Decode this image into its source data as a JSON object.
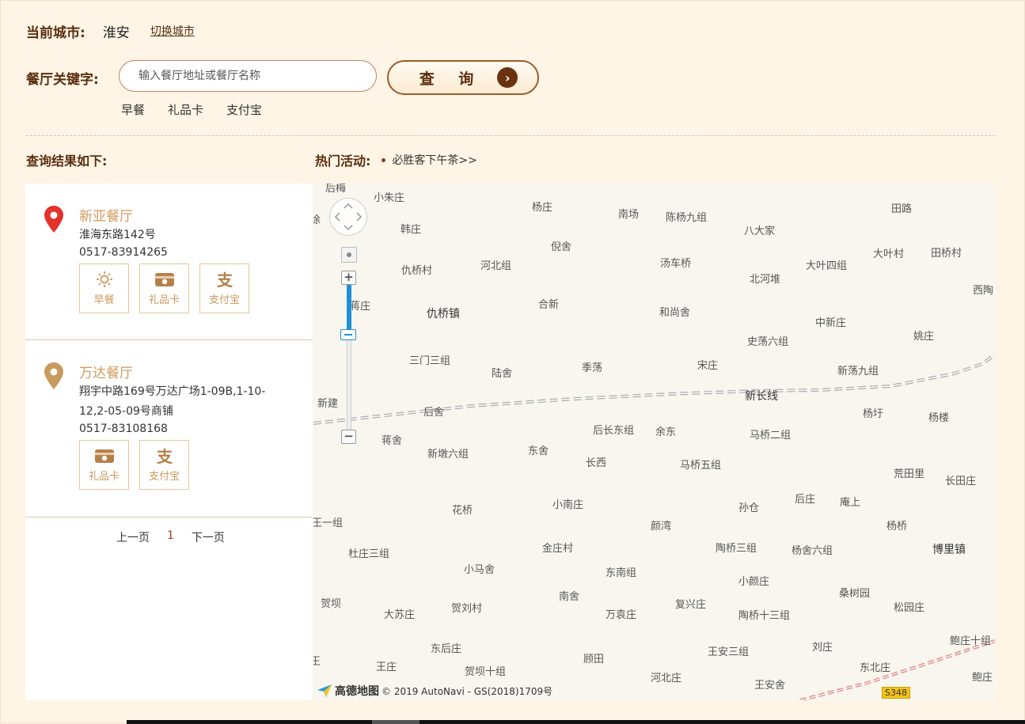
{
  "header": {
    "city_label": "当前城市:",
    "city_name": "淮安",
    "switch_city": "切换城市"
  },
  "search": {
    "label": "餐厅关键字:",
    "placeholder": "输入餐厅地址或餐厅名称",
    "value": "",
    "button_label": "查 询",
    "quick_tags": [
      "早餐",
      "礼品卡",
      "支付宝"
    ]
  },
  "results": {
    "title": "查询结果如下:",
    "stores": [
      {
        "name": "新亚餐厅",
        "address": "淮海东路142号",
        "phone": "0517-83914265",
        "pin_color": "#e1322b",
        "services": [
          "早餐",
          "礼品卡",
          "支付宝"
        ]
      },
      {
        "name": "万达餐厅",
        "address": "翔宇中路169号万达广场1-09B,1-10-12,2-05-09号商铺",
        "phone": "0517-83108168",
        "pin_color": "#c99a5e",
        "services": [
          "礼品卡",
          "支付宝"
        ]
      }
    ],
    "pager": {
      "prev": "上一页",
      "current": "1",
      "next": "下一页"
    }
  },
  "hot": {
    "label": "热门活动:",
    "link": "必胜客下午茶>>"
  },
  "map": {
    "attribution_logo": "高德地图",
    "attribution": "© 2019 AutoNavi - GS(2018)1709号",
    "road_shield": "S348",
    "labels": [
      "后梅",
      "小朱庄",
      "杨庄",
      "南场",
      "陈杨九组",
      "田路",
      "八大家",
      "徐",
      "韩庄",
      "倪舍",
      "大叶村",
      "田桥村",
      "汤车桥",
      "仇桥村",
      "河北组",
      "北河堆",
      "大叶四组",
      "西陶",
      "蒋庄",
      "合新",
      "仇桥镇",
      "和尚舍",
      "中新庄",
      "姚庄",
      "史荡六组",
      "三门三组",
      "季荡",
      "宋庄",
      "陆舍",
      "新荡九组",
      "新建",
      "新长线",
      "后舍",
      "杨圩",
      "杨楼",
      "后长东组",
      "余东",
      "蒋舍",
      "马桥二组",
      "东舍",
      "新墩六组",
      "长西",
      "马桥五组",
      "荒田里",
      "长田庄",
      "小南庄",
      "花桥",
      "后庄",
      "庵上",
      "孙仓",
      "王一组",
      "颜湾",
      "杨桥",
      "杜庄三组",
      "金庄村",
      "陶桥三组",
      "杨舍六组",
      "博里镇",
      "小马舍",
      "东南组",
      "小颜庄",
      "贺坝",
      "南舍",
      "桑树园",
      "大苏庄",
      "贺刘村",
      "万袁庄",
      "复兴庄",
      "陶桥十三组",
      "松园庄",
      "东后庄",
      "刘庄",
      "鲍庄十组",
      "王安三组",
      "王",
      "王庄",
      "顾田",
      "贺坝十组",
      "东北庄",
      "河北庄",
      "王安舍",
      "鲍庄"
    ]
  }
}
